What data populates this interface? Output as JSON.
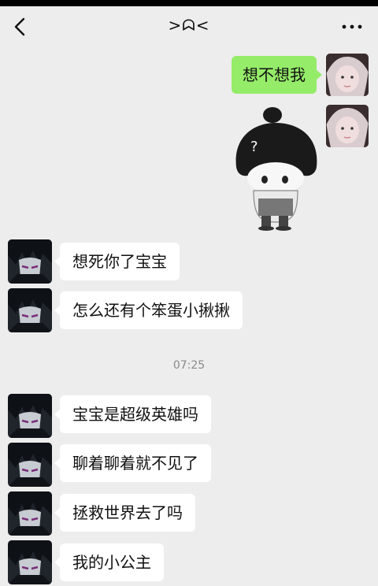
{
  "header": {
    "title": ">ᗣ<",
    "back_icon": "back-chevron-icon",
    "more_icon": "more-dots-icon"
  },
  "messages_sent": [
    {
      "text": "想不想我"
    }
  ],
  "sticker": {
    "glyph": "?"
  },
  "messages_received_1": [
    {
      "text": "想死你了宝宝"
    },
    {
      "text": "怎么还有个笨蛋小揪揪"
    }
  ],
  "timestamp": "07:25",
  "messages_received_2": [
    {
      "text": "宝宝是超级英雄吗"
    },
    {
      "text": "聊着聊着就不见了"
    },
    {
      "text": "拯救世界去了吗"
    },
    {
      "text": "我的小公主"
    }
  ],
  "colors": {
    "bg": "#ededed",
    "sent_bubble": "#95ec69",
    "received_bubble": "#ffffff"
  }
}
